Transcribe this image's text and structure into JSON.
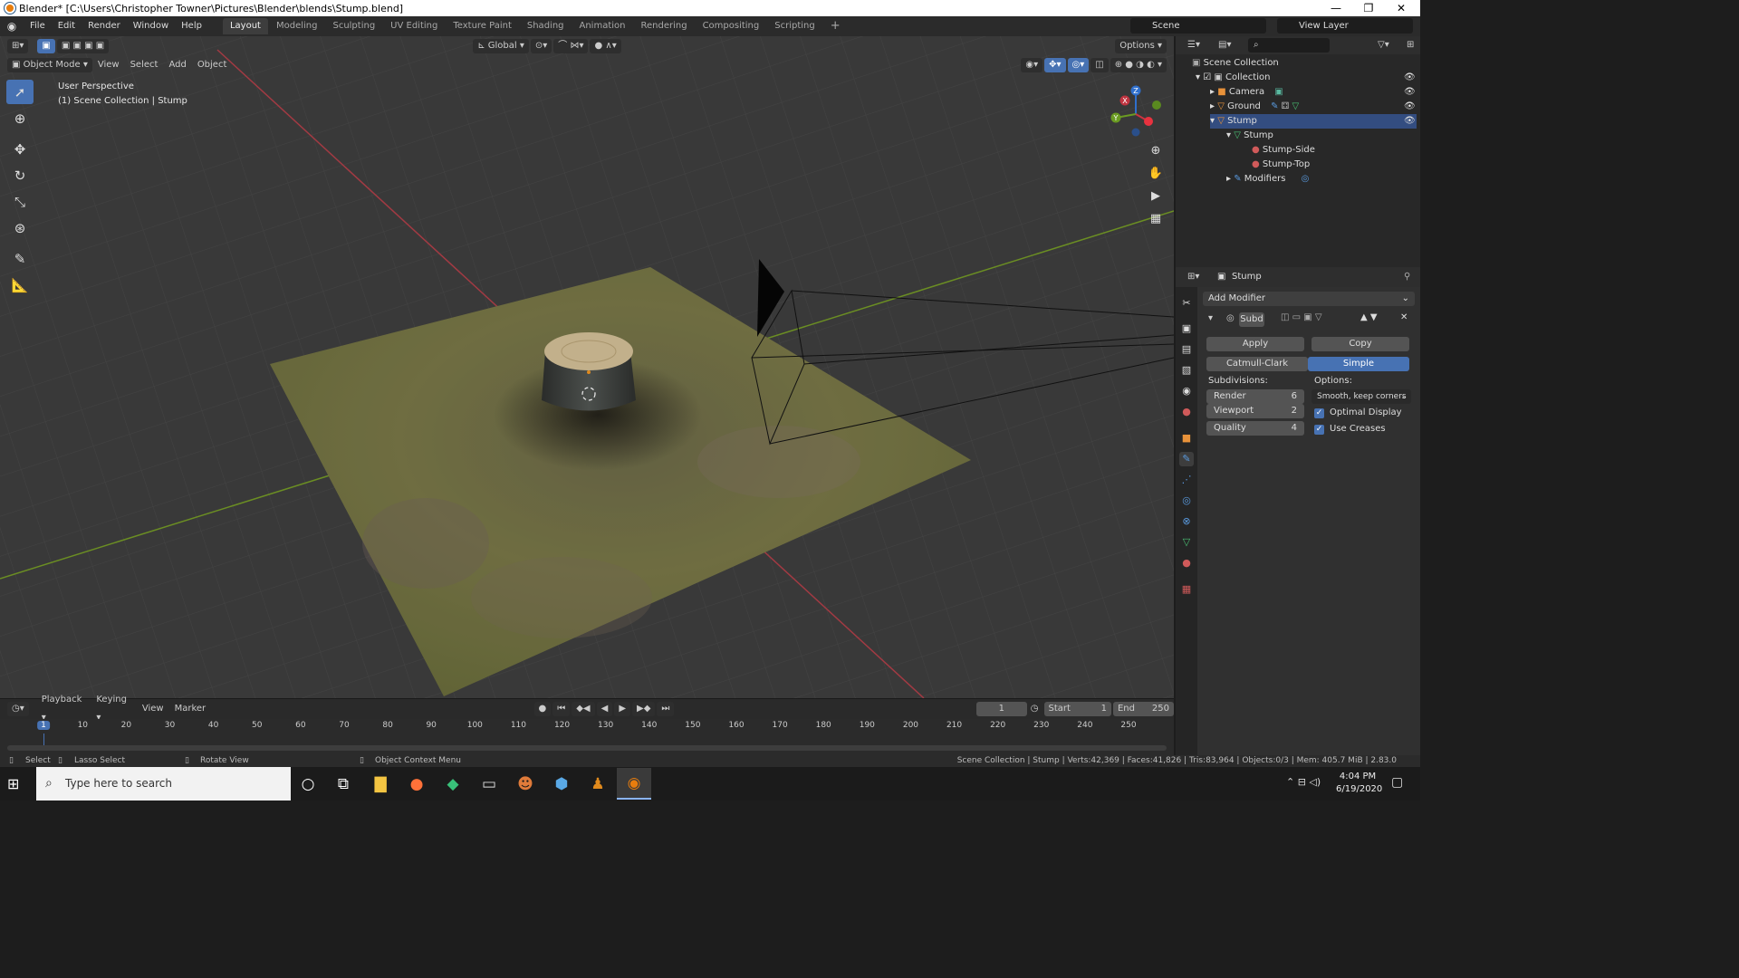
{
  "window": {
    "title": "Blender* [C:\\Users\\Christopher Towner\\Pictures\\Blender\\blends\\Stump.blend]",
    "controls": [
      "—",
      "❐",
      "✕"
    ]
  },
  "menubar": {
    "menus": [
      "File",
      "Edit",
      "Render",
      "Window",
      "Help"
    ],
    "workspaces": [
      "Layout",
      "Modeling",
      "Sculpting",
      "UV Editing",
      "Texture Paint",
      "Shading",
      "Animation",
      "Rendering",
      "Compositing",
      "Scripting"
    ],
    "add_workspace": "+",
    "scene": "Scene",
    "view_layer": "View Layer"
  },
  "viewport_header": {
    "transform_orientation": "Global",
    "options": "Options",
    "mode": "Object Mode",
    "menus": [
      "View",
      "Select",
      "Add",
      "Object"
    ]
  },
  "viewport": {
    "perspective": "User Perspective",
    "collection_path": "(1) Scene Collection | Stump",
    "gizmo_labels": {
      "z": "Z",
      "y": "Y",
      "x": "X"
    }
  },
  "outliner": {
    "root": "Scene Collection",
    "items": [
      {
        "label": "Collection",
        "icon": "collection-icon"
      },
      {
        "label": "Camera",
        "icon": "camera-object-icon"
      },
      {
        "label": "Ground",
        "icon": "mesh-object-icon"
      },
      {
        "label": "Stump",
        "icon": "mesh-object-icon"
      },
      {
        "label": "Stump",
        "icon": "mesh-data-icon"
      },
      {
        "label": "Stump-Side",
        "icon": "material-icon"
      },
      {
        "label": "Stump-Top",
        "icon": "material-icon"
      },
      {
        "label": "Modifiers",
        "icon": "wrench-icon"
      }
    ]
  },
  "properties": {
    "object_name": "Stump",
    "add_modifier": "Add Modifier",
    "modifier_name": "Subd",
    "apply": "Apply",
    "copy": "Copy",
    "catmull_clark": "Catmull-Clark",
    "simple": "Simple",
    "subdivisions_label": "Subdivisions:",
    "options_label": "Options:",
    "render_label": "Render",
    "render_value": "6",
    "viewport_label": "Viewport",
    "viewport_value": "2",
    "quality_label": "Quality",
    "quality_value": "4",
    "uv_smooth": "Smooth, keep corners",
    "optimal_display": "Optimal Display",
    "use_creases": "Use Creases",
    "check_mark": "✓"
  },
  "timeline": {
    "menus": [
      "Playback",
      "Keying",
      "View",
      "Marker"
    ],
    "current_frame": "1",
    "start_label": "Start",
    "start_value": "1",
    "end_label": "End",
    "end_value": "250",
    "ruler": [
      "1",
      "10",
      "20",
      "30",
      "40",
      "50",
      "60",
      "70",
      "80",
      "90",
      "100",
      "110",
      "120",
      "130",
      "140",
      "150",
      "160",
      "170",
      "180",
      "190",
      "200",
      "210",
      "220",
      "230",
      "240",
      "250"
    ]
  },
  "statusbar": {
    "select": "Select",
    "lasso": "Lasso Select",
    "rotate": "Rotate View",
    "context": "Object Context Menu",
    "stats": "Scene Collection | Stump | Verts:42,369 | Faces:41,826 | Tris:83,964 | Objects:0/3 | Mem: 405.7 MiB | 2.83.0"
  },
  "taskbar": {
    "search_placeholder": "Type here to search",
    "time": "4:04 PM",
    "date": "6/19/2020"
  }
}
